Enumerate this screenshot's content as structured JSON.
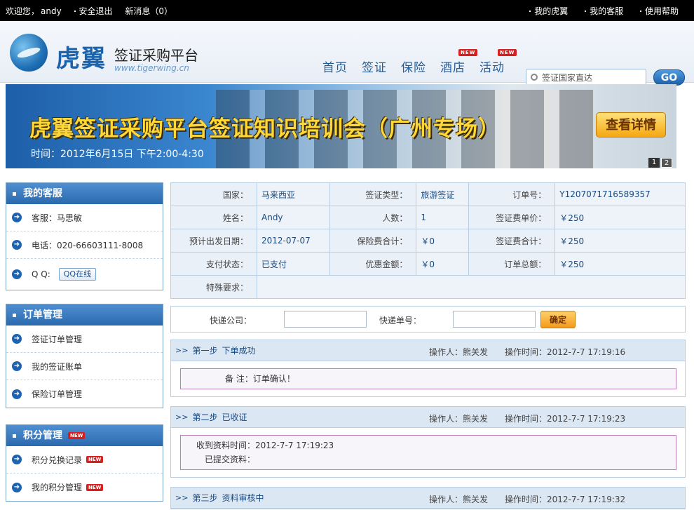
{
  "topbar": {
    "welcome": "欢迎您，",
    "user": "andy",
    "logout": "安全退出",
    "messages": "新消息（0）",
    "links": [
      "我的虎翼",
      "我的客服",
      "使用帮助"
    ]
  },
  "header": {
    "logo_cn": "虎翼",
    "logo_title": "签证采购平台",
    "logo_url": "www.tigerwing.cn",
    "nav": [
      {
        "label": "首页",
        "new": false
      },
      {
        "label": "签证",
        "new": false
      },
      {
        "label": "保险",
        "new": false
      },
      {
        "label": "酒店",
        "new": true
      },
      {
        "label": "活动",
        "new": true
      }
    ],
    "new_badge": "NEW",
    "search_placeholder": "签证国家直达",
    "go_label": "GO"
  },
  "banner": {
    "title": "虎翼签证采购平台签证知识培训会（广州专场）",
    "time": "时间：2012年6月15日 下午2:00-4:30",
    "detail_button": "查看详情",
    "pages": [
      "1",
      "2"
    ]
  },
  "sidebar": {
    "service": {
      "title": "我的客服",
      "items": [
        "客服：马思敏",
        "电话：020-66603111-8008",
        "Q  Q:"
      ],
      "qq_label": "QQ在线"
    },
    "orders": {
      "title": "订单管理",
      "items": [
        "签证订单管理",
        "我的签证账单",
        "保险订单管理"
      ]
    },
    "points": {
      "title": "积分管理",
      "items": [
        "积分兑换记录",
        "我的积分管理"
      ]
    }
  },
  "order": {
    "country_label": "国家：",
    "country": "马来西亚",
    "visa_type_label": "签证类型：",
    "visa_type": "旅游签证",
    "order_no_label": "订单号：",
    "order_no": "Y1207071716589357",
    "name_label": "姓名：",
    "name": "Andy",
    "count_label": "人数：",
    "count": "1",
    "unit_price_label": "签证费单价：",
    "unit_price": "￥250",
    "depart_label": "预计出发日期：",
    "depart": "2012-07-07",
    "insurance_label": "保险费合计：",
    "insurance": "￥0",
    "visa_total_label": "签证费合计：",
    "visa_total": "￥250",
    "pay_status_label": "支付状态：",
    "pay_status": "已支付",
    "discount_label": "优惠金额：",
    "discount": "￥0",
    "total_label": "订单总额：",
    "total": "￥250",
    "special_label": "特殊要求：",
    "special": ""
  },
  "express": {
    "company_label": "快递公司：",
    "number_label": "快递单号：",
    "company_value": "",
    "number_value": "",
    "confirm_label": "确定"
  },
  "steps": [
    {
      "chev": ">>",
      "step": "第一步",
      "name": "下单成功",
      "operator": "操作人：熊关发",
      "time": "操作时间：2012-7-7  17:19:16",
      "notes": [
        "备 注：订单确认！"
      ]
    },
    {
      "chev": ">>",
      "step": "第二步",
      "name": "已收证",
      "operator": "操作人：熊关发",
      "time": "操作时间：2012-7-7  17:19:23",
      "notes": [
        "收到资料时间：2012-7-7  17:19:23",
        "已提交资料："
      ]
    },
    {
      "chev": ">>",
      "step": "第三步",
      "name": "资料审核中",
      "operator": "操作人：熊关发",
      "time": "操作时间：2012-7-7  17:19:32",
      "notes": []
    }
  ]
}
